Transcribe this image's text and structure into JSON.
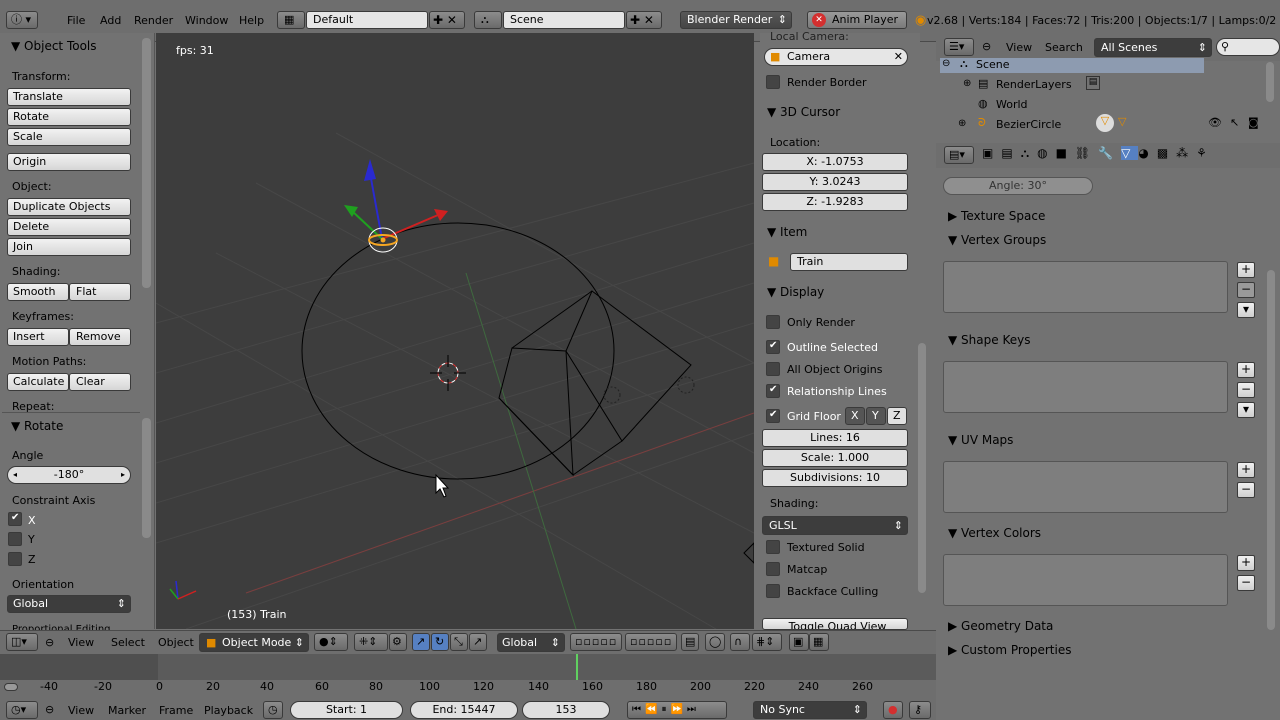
{
  "menubar": {
    "items": [
      "File",
      "Add",
      "Render",
      "Window",
      "Help"
    ],
    "layout": "Default",
    "scene": "Scene",
    "engine": "Blender Render",
    "anim_player": "Anim Player",
    "stats": "v2.68 | Verts:184 | Faces:72 | Tris:200 | Objects:1/7 | Lamps:0/2 | M"
  },
  "toolshelf": {
    "title": "Object Tools",
    "transform_label": "Transform:",
    "translate": "Translate",
    "rotate": "Rotate",
    "scale": "Scale",
    "origin": "Origin",
    "object_label": "Object:",
    "duplicate": "Duplicate Objects",
    "delete": "Delete",
    "join": "Join",
    "shading_label": "Shading:",
    "smooth": "Smooth",
    "flat": "Flat",
    "keyframes_label": "Keyframes:",
    "insert": "Insert",
    "remove": "Remove",
    "motion_label": "Motion Paths:",
    "calculate": "Calculate",
    "clear": "Clear",
    "repeat_label": "Repeat:",
    "rotate_panel": "Rotate",
    "angle_label": "Angle",
    "angle_value": "-180°",
    "constraint_label": "Constraint Axis",
    "axis_x": "X",
    "axis_y": "Y",
    "axis_z": "Z",
    "orientation_label": "Orientation",
    "orientation_value": "Global",
    "proportional": "Proportional Editing"
  },
  "viewport": {
    "fps": "fps: 31",
    "frame_label": "(153) Train"
  },
  "npanel": {
    "local_camera": "Local Camera:",
    "camera": "Camera",
    "render_border": "Render Border",
    "cursor_title": "3D Cursor",
    "location_label": "Location:",
    "x": "X: -1.0753",
    "y": "Y: 3.0243",
    "z": "Z: -1.9283",
    "item_title": "Item",
    "item_name": "Train",
    "display_title": "Display",
    "only_render": "Only Render",
    "outline_selected": "Outline Selected",
    "all_origins": "All Object Origins",
    "relationship": "Relationship Lines",
    "grid_floor": "Grid Floor",
    "gx": "X",
    "gy": "Y",
    "gz": "Z",
    "lines": "Lines: 16",
    "scale": "Scale: 1.000",
    "subdivisions": "Subdivisions: 10",
    "shading_label": "Shading:",
    "shading_value": "GLSL",
    "textured_solid": "Textured Solid",
    "matcap": "Matcap",
    "backface": "Backface Culling",
    "toggle_quad": "Toggle Quad View"
  },
  "outliner": {
    "view": "View",
    "search": "Search",
    "scenes": "All Scenes",
    "scene": "Scene",
    "renderlayers": "RenderLayers",
    "world": "World",
    "beziercircle": "BezierCircle"
  },
  "properties": {
    "angle": "Angle: 30°",
    "texture_space": "Texture Space",
    "vertex_groups": "Vertex Groups",
    "shape_keys": "Shape Keys",
    "uv_maps": "UV Maps",
    "vertex_colors": "Vertex Colors",
    "geometry_data": "Geometry Data",
    "custom_properties": "Custom Properties"
  },
  "view3d_header": {
    "view": "View",
    "select": "Select",
    "object": "Object",
    "mode": "Object Mode",
    "orientation": "Global"
  },
  "timeline": {
    "ticks": [
      "-40",
      "-20",
      "0",
      "20",
      "40",
      "60",
      "80",
      "100",
      "120",
      "140",
      "160",
      "180",
      "200",
      "220",
      "240",
      "260"
    ],
    "view": "View",
    "marker": "Marker",
    "frame": "Frame",
    "playback": "Playback",
    "start": "Start: 1",
    "end": "End: 15447",
    "current": "153",
    "sync": "No Sync"
  },
  "colors": {
    "viewport_bg": "#3d3d3d",
    "panel_bg": "#727272",
    "selection": "#f5a623",
    "anim_red": "#d32f2f"
  }
}
